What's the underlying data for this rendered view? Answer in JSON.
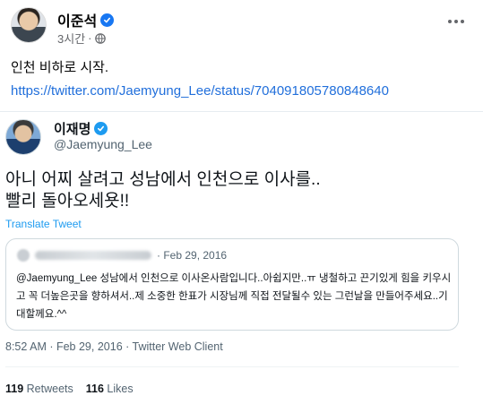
{
  "post": {
    "author": "이준석",
    "time": "3시간",
    "meta_separator": "·",
    "text": "인천 비하로 시작.",
    "link": "https://twitter.com/Jaemyung_Lee/status/704091805780848640"
  },
  "tweet": {
    "name": "이재명",
    "handle": "@Jaemyung_Lee",
    "text_line1": "아니 어찌 살려고 성남에서 인천으로 이사를..",
    "text_line2": "빨리 돌아오세욧!!",
    "translate_label": "Translate Tweet",
    "quote": {
      "date": "· Feb 29, 2016",
      "text": "@Jaemyung_Lee 성남에서 인천으로 이사온사람입니다..아쉽지만..ㅠ 냉철하고 끈기있게 힘을 키우시고 꼭 더높은곳을 향하셔서..제 소중한 한표가 시장님께 직접 전달될수 있는 그런날을 만들어주세요..기대할께요.^^"
    },
    "timestamp": "8:52 AM · Feb 29, 2016 · Twitter Web Client",
    "retweets_count": "119",
    "retweets_label": "Retweets",
    "likes_count": "116",
    "likes_label": "Likes"
  },
  "colors": {
    "fb_link": "#216fdb",
    "fb_verified": "#1877f2",
    "twitter_blue": "#1d9bf0"
  },
  "icons": [
    "verified-badge-icon",
    "globe-icon",
    "more-options-icon"
  ]
}
